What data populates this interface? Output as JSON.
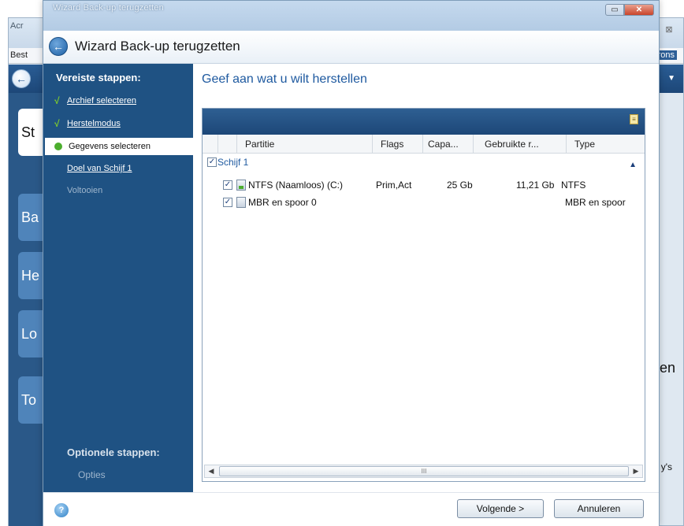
{
  "background_app": {
    "title_fragment": "Acr",
    "menu_fragment": "Best",
    "menu_right_fragment": "rons",
    "close_glyph": "⊠",
    "side_buttons": [
      "St",
      "Ba",
      "He",
      "Lo",
      "To"
    ],
    "right_text": "ten",
    "right_small": "y's"
  },
  "wizard": {
    "window_title": "Wizard Back-up terugzetten",
    "heading": "Wizard Back-up terugzetten",
    "controls": {
      "minimize": "▭",
      "close": "✕"
    }
  },
  "nav": {
    "required_header": "Vereiste stappen:",
    "items": [
      {
        "label": "Archief selecteren",
        "state": "done"
      },
      {
        "label": "Herstelmodus",
        "state": "done"
      },
      {
        "label": "Gegevens selecteren",
        "state": "current"
      },
      {
        "label": "Doel van Schijf 1",
        "state": "link"
      },
      {
        "label": "Voltooien",
        "state": "disabled"
      }
    ],
    "check_glyph": "√",
    "optional_header": "Optionele stappen:",
    "optional_items": [
      "Opties"
    ]
  },
  "content": {
    "heading": "Geef aan wat u wilt herstellen",
    "columns": [
      "Partitie",
      "Flags",
      "Capa...",
      "Gebruikte r...",
      "Type"
    ],
    "group": {
      "label": "Schijf 1",
      "checked": true
    },
    "rows": [
      {
        "partition": "NTFS (Naamloos) (C:)",
        "flags": "Prim,Act",
        "capacity": "25 Gb",
        "used": "11,21 Gb",
        "type": "NTFS",
        "checked": true
      },
      {
        "partition": "MBR en spoor 0",
        "flags": "",
        "capacity": "",
        "used": "",
        "type": "MBR en spoor",
        "checked": true
      }
    ],
    "scroll_thumb_glyph": "III"
  },
  "footer": {
    "help_glyph": "?",
    "next_label": "Volgende >",
    "cancel_label": "Annuleren"
  },
  "colors": {
    "nav_bg": "#1f5283",
    "heading_blue": "#1f5aa0",
    "check_green": "#7ecb2d",
    "table_header_bg": "#2e5f92"
  }
}
